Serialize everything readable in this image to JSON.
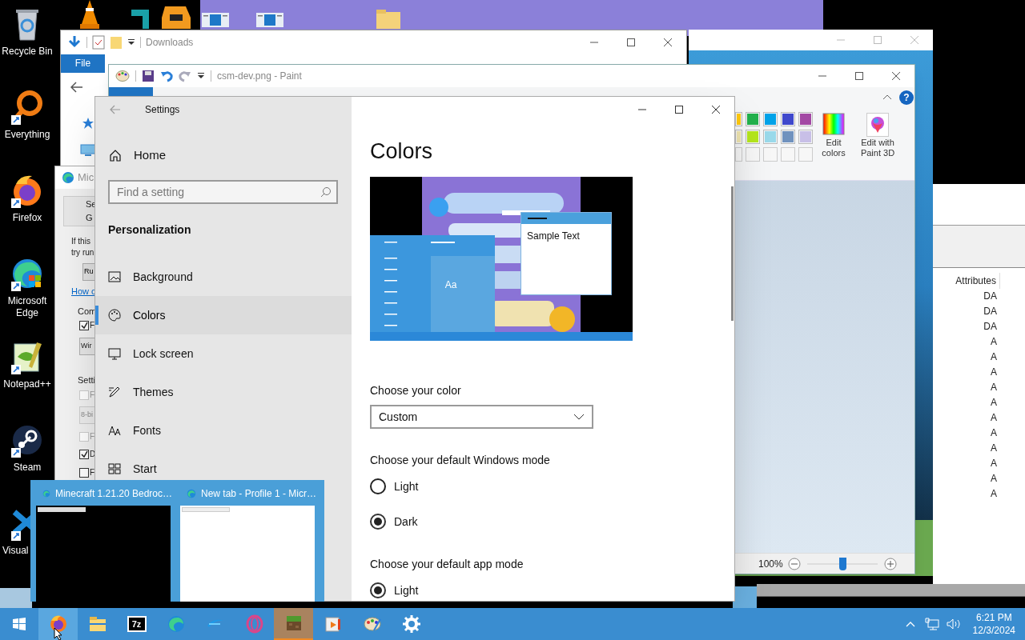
{
  "desktop_icons": [
    {
      "label": "Recycle Bin"
    },
    {
      "label": "Everything"
    },
    {
      "label": "Firefox"
    },
    {
      "label": "Microsoft Edge"
    },
    {
      "label": "Notepad++"
    },
    {
      "label": "Steam"
    },
    {
      "label": "Visual"
    }
  ],
  "explorer_window": {
    "title": "Downloads",
    "tabs": [
      {
        "label": "File",
        "selected": true
      }
    ]
  },
  "attributes_window": {
    "column": "Attributes",
    "rows": [
      "DA",
      "DA",
      "DA",
      "A",
      "A",
      "A",
      "A",
      "A",
      "A",
      "A",
      "A",
      "A",
      "A",
      "A"
    ]
  },
  "paint_window": {
    "title": "csm-dev.png - Paint",
    "help": "?",
    "palette": [
      {
        "color": "#ffc90e"
      },
      {
        "color": "#22b14c"
      },
      {
        "color": "#00a2e8"
      },
      {
        "color": "#3f48cc"
      },
      {
        "color": "#a349a4"
      },
      {
        "color": "#efe4b0"
      },
      {
        "color": "#b5e61d"
      },
      {
        "color": "#99d9ea"
      },
      {
        "color": "#7092be"
      },
      {
        "color": "#c8bfe7"
      }
    ],
    "edit_colors": "Edit colors",
    "edit_paint3d": "Edit with Paint 3D",
    "zoom": "100%",
    "zoom_slider": {
      "level": 0.5
    }
  },
  "store_window": {
    "title": "Mic",
    "items": [
      {
        "kind": "tab",
        "text": "Se"
      },
      {
        "kind": "tab",
        "text": "G"
      },
      {
        "kind": "text",
        "text": "If this"
      },
      {
        "kind": "text",
        "text": "try run"
      },
      {
        "kind": "button",
        "text": "Ru"
      },
      {
        "kind": "link",
        "text": "How c"
      },
      {
        "kind": "group",
        "text": "Com"
      },
      {
        "kind": "checkbox",
        "text": "F",
        "checked": true,
        "disabled": false
      },
      {
        "kind": "dropdown",
        "text": "Wir",
        "disabled": false
      },
      {
        "kind": "group",
        "text": "Setti"
      },
      {
        "kind": "checkbox",
        "text": "F",
        "checked": false,
        "disabled": true
      },
      {
        "kind": "dropdown",
        "text": "8-bi",
        "disabled": true
      },
      {
        "kind": "checkbox",
        "text": "F",
        "checked": false,
        "disabled": true
      },
      {
        "kind": "checkbox",
        "text": "D",
        "checked": true,
        "disabled": false
      },
      {
        "kind": "checkbox",
        "text": "F",
        "checked": false,
        "disabled": false
      }
    ]
  },
  "settings": {
    "title": "Settings",
    "home": "Home",
    "search_placeholder": "Find a setting",
    "section": "Personalization",
    "nav": [
      {
        "label": "Background",
        "selected": false
      },
      {
        "label": "Colors",
        "selected": true
      },
      {
        "label": "Lock screen",
        "selected": false
      },
      {
        "label": "Themes",
        "selected": false
      },
      {
        "label": "Fonts",
        "selected": false
      },
      {
        "label": "Start",
        "selected": false
      }
    ],
    "page_title": "Colors",
    "preview": {
      "tile": "Aa",
      "sample_text": "Sample Text"
    },
    "color_label": "Choose your color",
    "color_value": "Custom",
    "windows_mode": {
      "label": "Choose your default Windows mode",
      "options": [
        {
          "label": "Light",
          "selected": false
        },
        {
          "label": "Dark",
          "selected": true
        }
      ]
    },
    "app_mode": {
      "label": "Choose your default app mode",
      "options": [
        {
          "label": "Light",
          "selected": true
        }
      ]
    }
  },
  "thumbnails": [
    {
      "title": "Minecraft 1.21.20 Bedroc…",
      "kind": "dark"
    },
    {
      "title": "New tab - Profile 1 - Micr…",
      "kind": "light"
    }
  ],
  "taskbar": {
    "apps": [
      {
        "selected": false,
        "hovered": true
      },
      {
        "selected": false,
        "hovered": false
      },
      {
        "selected": false,
        "hovered": false,
        "label": "7z"
      },
      {
        "selected": false,
        "hovered": false
      },
      {
        "selected": false,
        "hovered": false
      },
      {
        "selected": false,
        "hovered": false
      },
      {
        "selected": true,
        "hovered": false
      },
      {
        "selected": false,
        "hovered": false
      },
      {
        "selected": false,
        "hovered": false
      },
      {
        "selected": false,
        "hovered": false
      }
    ],
    "time": "6:21 PM",
    "date": "12/3/2024"
  }
}
